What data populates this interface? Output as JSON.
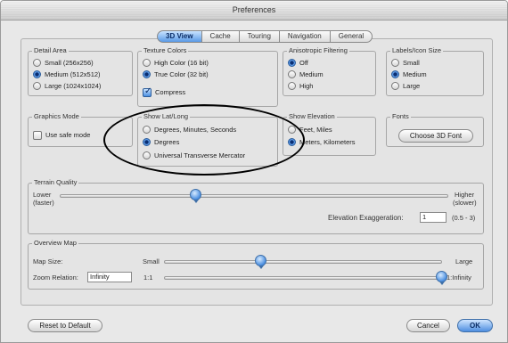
{
  "window": {
    "title": "Preferences"
  },
  "tabs": [
    {
      "label": "3D View",
      "active": true
    },
    {
      "label": "Cache",
      "active": false
    },
    {
      "label": "Touring",
      "active": false
    },
    {
      "label": "Navigation",
      "active": false
    },
    {
      "label": "General",
      "active": false
    }
  ],
  "detail_area": {
    "legend": "Detail Area",
    "options": [
      {
        "label": "Small (256x256)",
        "selected": false
      },
      {
        "label": "Medium (512x512)",
        "selected": true
      },
      {
        "label": "Large (1024x1024)",
        "selected": false
      }
    ]
  },
  "texture_colors": {
    "legend": "Texture Colors",
    "options": [
      {
        "label": "High Color (16 bit)",
        "selected": false
      },
      {
        "label": "True Color (32 bit)",
        "selected": true
      }
    ],
    "compress_label": "Compress",
    "compress_checked": true
  },
  "anisotropic": {
    "legend": "Anisotropic Filtering",
    "options": [
      {
        "label": "Off",
        "selected": true
      },
      {
        "label": "Medium",
        "selected": false
      },
      {
        "label": "High",
        "selected": false
      }
    ]
  },
  "labels_icon_size": {
    "legend": "Labels/Icon Size",
    "options": [
      {
        "label": "Small",
        "selected": false
      },
      {
        "label": "Medium",
        "selected": true
      },
      {
        "label": "Large",
        "selected": false
      }
    ]
  },
  "graphics_mode": {
    "legend": "Graphics Mode",
    "safe_mode_label": "Use safe mode",
    "safe_mode_checked": false
  },
  "show_lat_long": {
    "legend": "Show Lat/Long",
    "options": [
      {
        "label": "Degrees, Minutes, Seconds",
        "selected": false
      },
      {
        "label": "Degrees",
        "selected": true
      },
      {
        "label": "Universal Transverse Mercator",
        "selected": false
      }
    ]
  },
  "show_elevation": {
    "legend": "Show Elevation",
    "options": [
      {
        "label": "Feet, Miles",
        "selected": false
      },
      {
        "label": "Meters, Kilometers",
        "selected": true
      }
    ]
  },
  "fonts": {
    "legend": "Fonts",
    "choose_button": "Choose 3D Font"
  },
  "terrain_quality": {
    "legend": "Terrain Quality",
    "lower_label": "Lower",
    "lower_sub": "(faster)",
    "higher_label": "Higher",
    "higher_sub": "(slower)",
    "slider_fraction": 0.35,
    "elevation_label": "Elevation Exaggeration:",
    "elevation_value": "1",
    "elevation_range": "(0.5 - 3)"
  },
  "overview_map": {
    "legend": "Overview Map",
    "map_size_label": "Map Size:",
    "small_label": "Small",
    "large_label": "Large",
    "map_size_fraction": 0.35,
    "zoom_label": "Zoom Relation:",
    "zoom_value": "Infinity",
    "zoom_min": "1:1",
    "zoom_max": "1:Infinity",
    "zoom_fraction": 1.0
  },
  "footer": {
    "reset_button": "Reset to Default",
    "cancel_button": "Cancel",
    "ok_button": "OK"
  }
}
